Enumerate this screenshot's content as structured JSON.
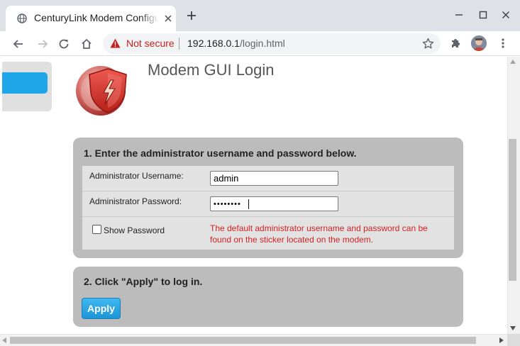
{
  "browser": {
    "tab_title": "CenturyLink Modem Configuration",
    "security_label": "Not secure",
    "url_host": "192.168.0.1",
    "url_path": "/login.html"
  },
  "page": {
    "title": "Modem GUI Login"
  },
  "step1": {
    "heading": "1. Enter the administrator username and password below.",
    "username_label": "Administrator Username:",
    "username_value": "admin",
    "password_label": "Administrator Password:",
    "password_value": "••••••••",
    "show_password_label": "Show Password",
    "show_password_checked": false,
    "hint": "The default administrator username and password can be found on the sticker located on the modem."
  },
  "step2": {
    "heading": "2. Click \"Apply\" to log in.",
    "apply_label": "Apply"
  },
  "colors": {
    "accent": "#1ea6e8",
    "panel_background": "#bcbcbc",
    "hint_text": "#d32222",
    "not_secure": "#c5221f"
  },
  "icons": [
    "globe-icon",
    "close-icon",
    "plus-icon",
    "minimize-icon",
    "maximize-icon",
    "window-close-icon",
    "back-arrow-icon",
    "forward-arrow-icon",
    "reload-icon",
    "home-icon",
    "warning-icon",
    "star-icon",
    "puzzle-icon",
    "kebab-menu-icon",
    "shield-logo-icon"
  ]
}
